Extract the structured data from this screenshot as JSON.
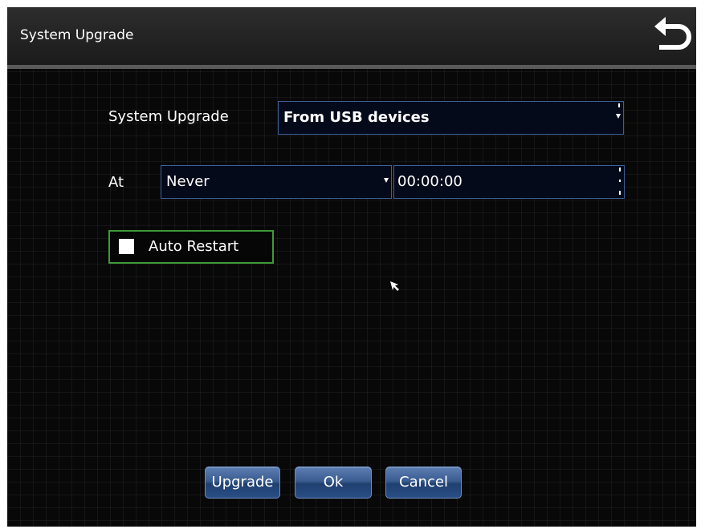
{
  "header": {
    "title": "System Upgrade",
    "back_icon": "back-arrow-icon"
  },
  "form": {
    "upgrade_label": "System Upgrade",
    "upgrade_source": "From USB devices",
    "at_label": "At",
    "schedule": "Never",
    "time": "00:00:00",
    "auto_restart_label": "Auto Restart",
    "auto_restart_checked": false
  },
  "buttons": {
    "upgrade": "Upgrade",
    "ok": "Ok",
    "cancel": "Cancel"
  },
  "colors": {
    "field_border": "#3c5f97",
    "focus_border": "#3f9a3a",
    "button_blue": "#2a4f86"
  }
}
